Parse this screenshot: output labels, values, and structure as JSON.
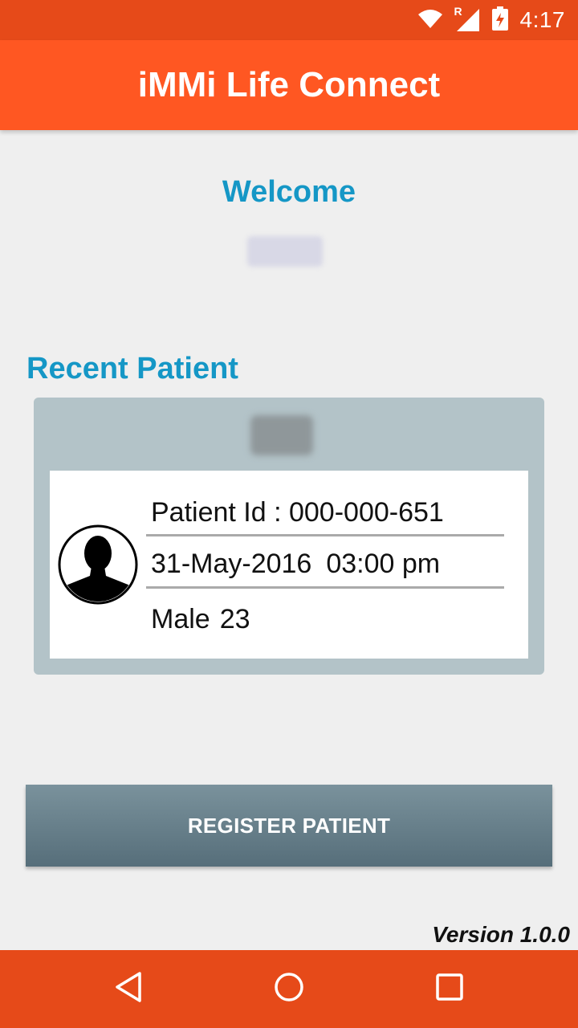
{
  "status_bar": {
    "time": "4:17",
    "icons": [
      "wifi-icon",
      "signal-icon",
      "battery-icon"
    ],
    "roaming_mark": "R"
  },
  "app_bar": {
    "title": "iMMi Life Connect"
  },
  "welcome": {
    "label": "Welcome"
  },
  "recent_patient": {
    "section_title": "Recent Patient",
    "patient_id": "Patient Id : 000-000-651",
    "date": "31-May-2016",
    "time": "03:00 pm",
    "gender": "Male",
    "age": "23"
  },
  "actions": {
    "register_label": "REGISTER PATIENT"
  },
  "footer": {
    "version": "Version 1.0.0"
  },
  "colors": {
    "status_bar": "#e64a19",
    "app_bar": "#ff5722",
    "accent_text": "#1597c6",
    "card_bg": "#b3c3c8",
    "button": "#667f8a"
  },
  "nav": {
    "icons": [
      "back-icon",
      "home-icon",
      "recents-icon"
    ]
  }
}
